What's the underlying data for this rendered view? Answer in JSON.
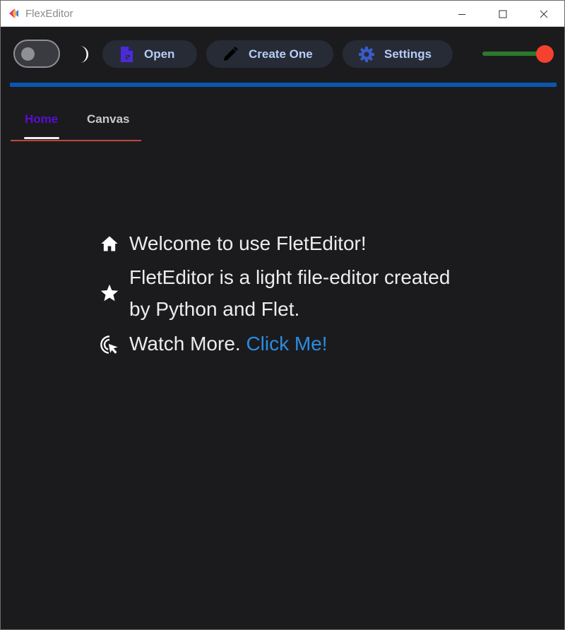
{
  "window": {
    "title": "FlexEditor",
    "controls": [
      "minimize-icon",
      "maximize-icon",
      "close-icon"
    ]
  },
  "toolbar": {
    "theme_toggle": {
      "state": "off"
    },
    "theme_icon": "moon-icon",
    "open_label": "Open",
    "create_label": "Create One",
    "settings_label": "Settings",
    "slider": {
      "value": 1.0
    },
    "progress": {
      "value": 1.0
    }
  },
  "tabs": [
    {
      "label": "Home",
      "selected": true
    },
    {
      "label": "Canvas",
      "selected": false
    }
  ],
  "home": {
    "welcome": "Welcome to use FletEditor!",
    "description_line1": "FletEditor is a light file-editor created",
    "description_line2": "by Python and Flet.",
    "watch_more": "Watch More.",
    "link_text": "Click Me!"
  },
  "colors": {
    "background": "#1b1b1e",
    "button_bg": "#262b36",
    "button_text": "#b6cdf7",
    "progress": "#0a57b0",
    "slider_track": "#2b7a2b",
    "slider_thumb": "#f5412d",
    "tab_selected": "#5b0bd6",
    "tab_underline": "#c2453c",
    "link": "#2b8de0"
  }
}
